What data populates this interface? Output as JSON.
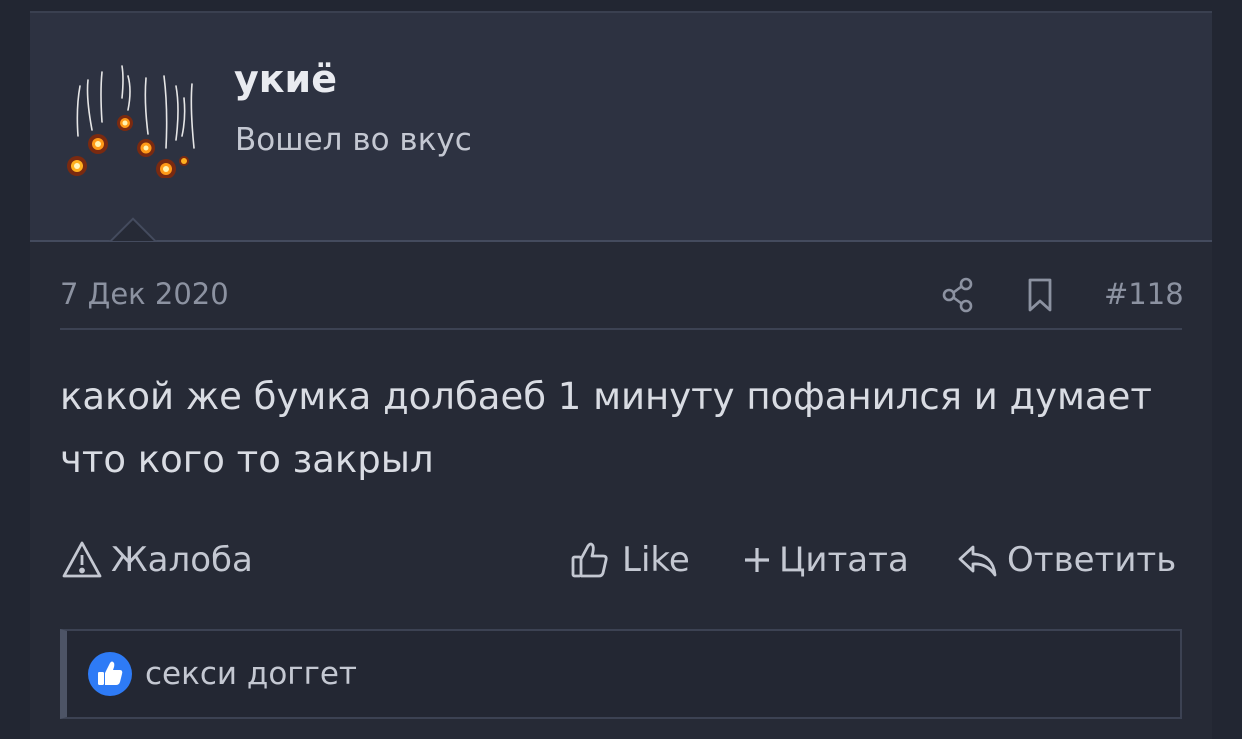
{
  "user": {
    "name": "укиё",
    "title": "Вошел во вкус",
    "avatar_icon": "falling-fireworks-avatar"
  },
  "meta": {
    "date": "7 Дек 2020",
    "post_number": "#118",
    "share_icon": "share-icon",
    "bookmark_icon": "bookmark-icon"
  },
  "message": {
    "text": "какой же бумка долбаеб 1 минуту пофанился и думает что кого то закрыл"
  },
  "actions": {
    "report_label": "Жалоба",
    "like_label": "Like",
    "quote_label": "Цитата",
    "reply_label": "Ответить"
  },
  "reactions": {
    "icon": "thumbs-up-reaction-icon",
    "text": "секси доггет"
  },
  "colors": {
    "page_bg": "#222632",
    "post_bg": "#262a36",
    "user_block_bg": "#2d3241",
    "text": "#d9dce3",
    "muted": "#8c92a1",
    "like_blue": "#2e7bf6"
  }
}
